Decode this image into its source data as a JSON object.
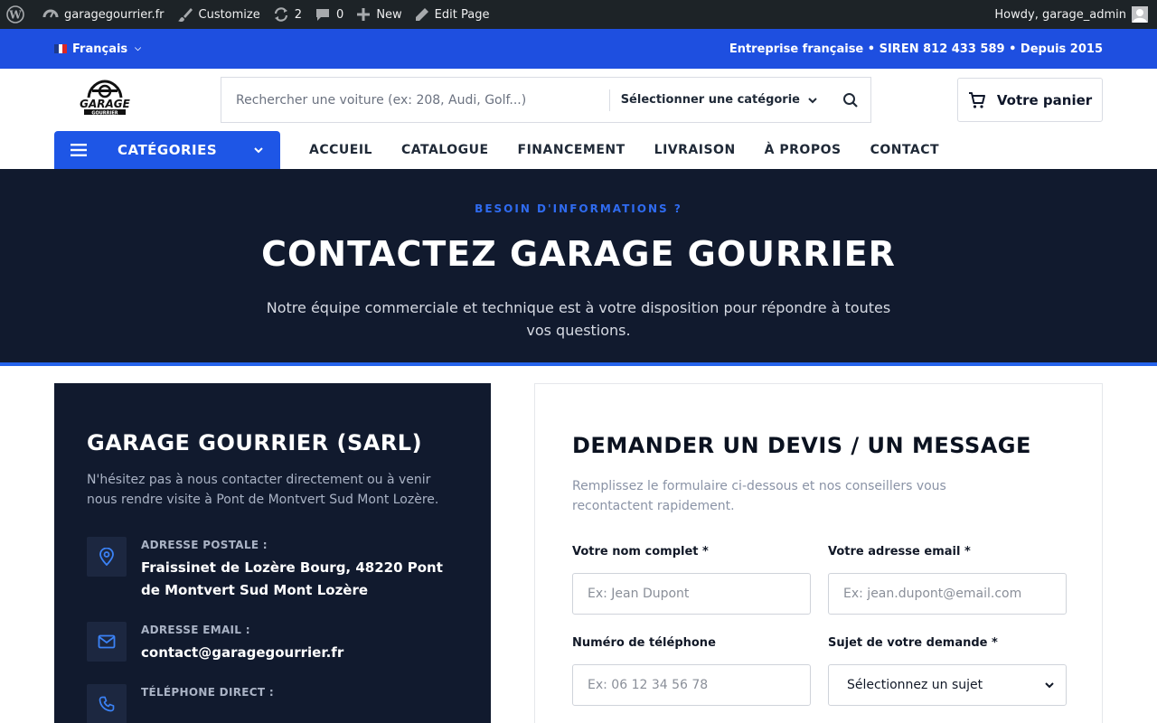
{
  "admin_bar": {
    "site": "garagegourrier.fr",
    "customize": "Customize",
    "updates": "2",
    "comments": "0",
    "new": "New",
    "edit_page": "Edit Page",
    "greeting": "Howdy, garage_admin"
  },
  "top_bar": {
    "language": "Français",
    "company_info": "Entreprise française • SIREN 812 433 589 • Depuis 2015"
  },
  "header": {
    "logo_text": "GARAGE",
    "logo_subtext": "GOURRIER",
    "search_placeholder": "Rechercher une voiture (ex: 208, Audi, Golf...)",
    "category_select": "Sélectionner une catégorie",
    "cart_label": "Votre panier"
  },
  "nav": {
    "categories_label": "CATÉGORIES",
    "items": [
      "ACCUEIL",
      "CATALOGUE",
      "FINANCEMENT",
      "LIVRAISON",
      "À PROPOS",
      "CONTACT"
    ]
  },
  "hero": {
    "eyebrow": "BESOIN D'INFORMATIONS ?",
    "title": "CONTACTEZ GARAGE GOURRIER",
    "subtitle": "Notre équipe commerciale et technique est à votre disposition pour répondre à toutes vos questions."
  },
  "contact_info": {
    "title": "GARAGE GOURRIER (SARL)",
    "intro": "N'hésitez pas à nous contacter directement ou à venir nous rendre visite à Pont de Montvert Sud Mont Lozère.",
    "address_label": "ADRESSE POSTALE :",
    "address_value": "Fraissinet de Lozère Bourg, 48220 Pont de Montvert Sud Mont Lozère",
    "email_label": "ADRESSE EMAIL :",
    "email_value": "contact@garagegourrier.fr",
    "phone_label": "TÉLÉPHONE DIRECT :"
  },
  "form": {
    "title": "DEMANDER UN DEVIS / UN MESSAGE",
    "intro": "Remplissez le formulaire ci-dessous et nos conseillers vous recontactent rapidement.",
    "name_label": "Votre nom complet *",
    "name_placeholder": "Ex: Jean Dupont",
    "email_label": "Votre adresse email *",
    "email_placeholder": "Ex: jean.dupont@email.com",
    "phone_label": "Numéro de téléphone",
    "phone_placeholder": "Ex: 06 12 34 56 78",
    "subject_label": "Sujet de votre demande *",
    "subject_value": "Sélectionnez un sujet"
  },
  "colors": {
    "primary_blue": "#1e4fe0",
    "dark_navy": "#111a2e",
    "admin_bar": "#1d2327"
  }
}
